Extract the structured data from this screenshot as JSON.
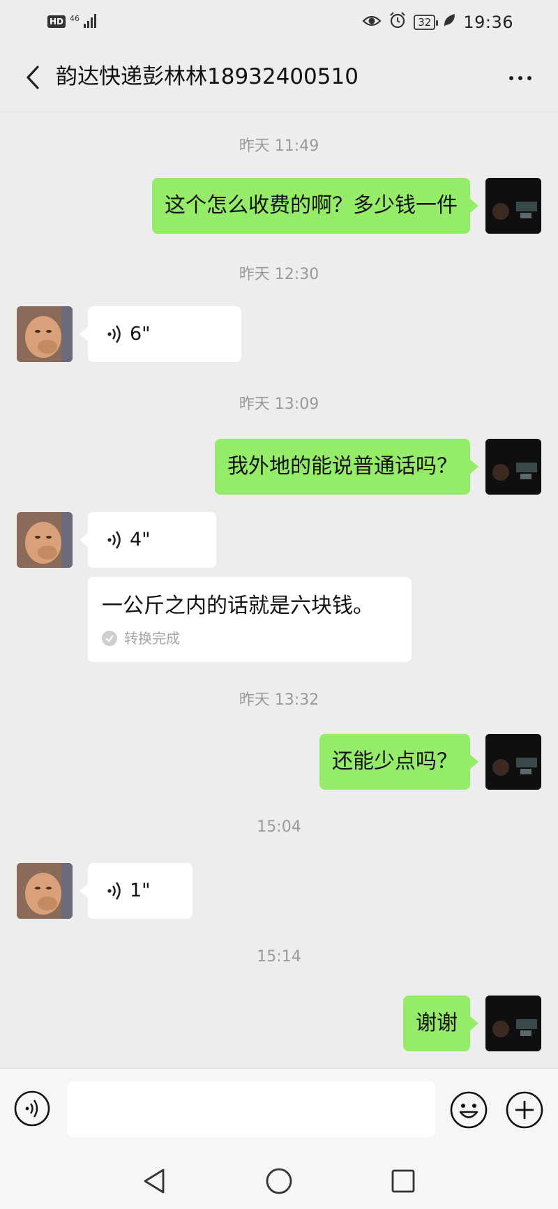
{
  "status_bar": {
    "hd_label": "HD",
    "network_label": "46",
    "battery_level": "32",
    "time": "19:36",
    "icons": [
      "eye-icon",
      "alarm-icon",
      "battery-icon",
      "leaf-icon"
    ]
  },
  "header": {
    "title": "韵达快递彭林林18932400510",
    "back_icon": "back-chevron-icon",
    "more_icon": "more-dots-icon"
  },
  "messages": [
    {
      "type": "timestamp",
      "text": "昨天 11:49"
    },
    {
      "type": "text",
      "sender": "me",
      "text": "这个怎么收费的啊？多少钱一件"
    },
    {
      "type": "timestamp",
      "text": "昨天 12:30"
    },
    {
      "type": "voice",
      "sender": "other",
      "duration": "6\""
    },
    {
      "type": "timestamp",
      "text": "昨天 13:09"
    },
    {
      "type": "text",
      "sender": "me",
      "text": "我外地的能说普通话吗？"
    },
    {
      "type": "voice",
      "sender": "other",
      "duration": "4\""
    },
    {
      "type": "transcript",
      "sender": "other",
      "text": "一公斤之内的话就是六块钱。",
      "status": "转换完成"
    },
    {
      "type": "timestamp",
      "text": "昨天 13:32"
    },
    {
      "type": "text",
      "sender": "me",
      "text": "还能少点吗？"
    },
    {
      "type": "timestamp",
      "text": "15:04"
    },
    {
      "type": "voice",
      "sender": "other",
      "duration": "1\""
    },
    {
      "type": "timestamp",
      "text": "15:14"
    },
    {
      "type": "text",
      "sender": "me",
      "text": "谢谢"
    }
  ],
  "input_bar": {
    "placeholder": "",
    "icons": [
      "voice-input-icon",
      "emoji-icon",
      "plus-icon"
    ]
  },
  "nav_bar": {
    "icons": [
      "back-triangle-icon",
      "home-circle-icon",
      "recents-square-icon"
    ]
  },
  "colors": {
    "background": "#ededed",
    "my_bubble": "#95ec69",
    "their_bubble": "#ffffff",
    "timestamp_text": "#9a9a9a"
  }
}
